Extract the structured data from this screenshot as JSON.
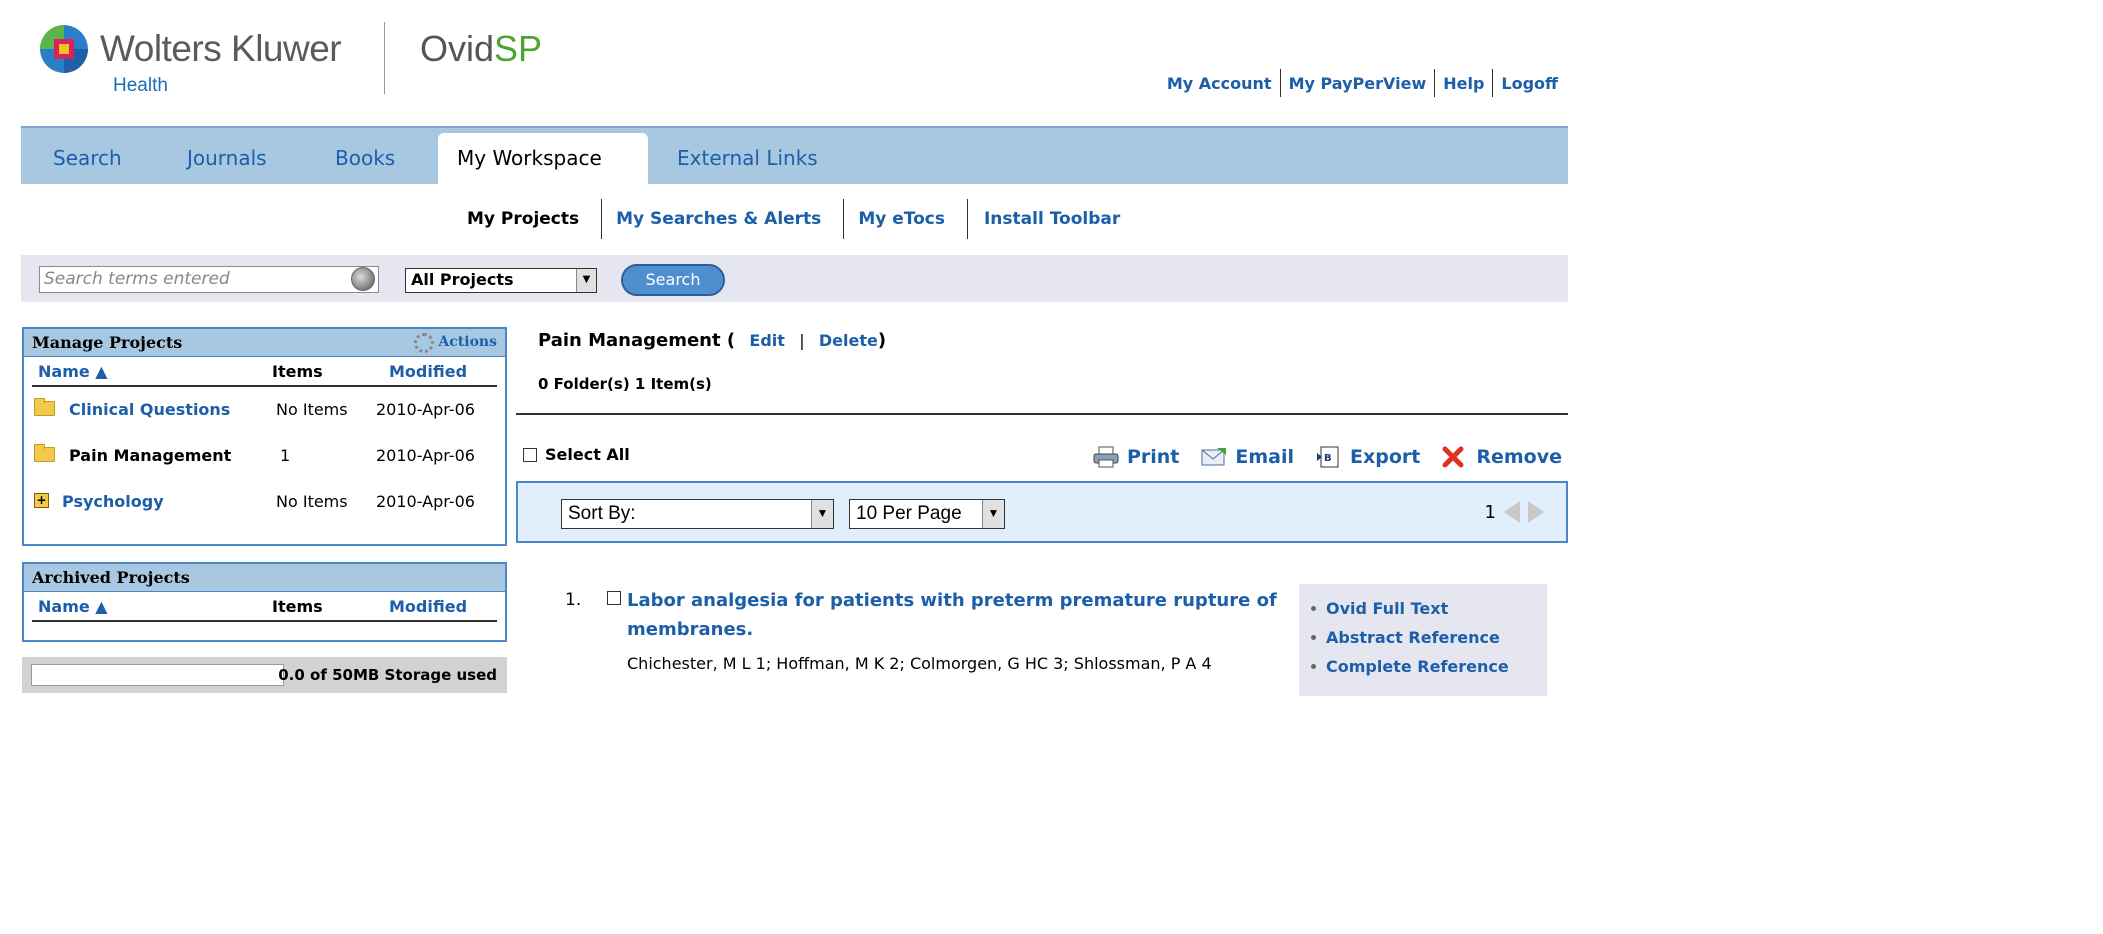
{
  "header": {
    "logo_text": "Wolters Kluwer",
    "logo_sub": "Health",
    "brand_prefix": "Ovid",
    "brand_suffix": "SP",
    "links": [
      "My Account",
      "My PayPerView",
      "Help",
      "Logoff"
    ]
  },
  "nav": {
    "tabs": [
      "Search",
      "Journals",
      "Books",
      "My Workspace",
      "External Links"
    ],
    "active_tab": "My Workspace"
  },
  "subnav": {
    "items": [
      "My Projects",
      "My Searches & Alerts",
      "My eTocs",
      "Install Toolbar"
    ],
    "active": "My Projects"
  },
  "search": {
    "placeholder": "Search terms entered",
    "scope": "All Projects",
    "button": "Search"
  },
  "manage_projects": {
    "title": "Manage Projects",
    "actions_label": "Actions",
    "columns": {
      "name": "Name ▲",
      "items": "Items",
      "modified": "Modified"
    },
    "rows": [
      {
        "name": "Clinical Questions",
        "items": "No Items",
        "modified": "2010-Apr-06",
        "icon": "folder-icon"
      },
      {
        "name": "Pain Management",
        "items": "1",
        "modified": "2010-Apr-06",
        "icon": "folder-icon"
      },
      {
        "name": "Psychology",
        "items": "No Items",
        "modified": "2010-Apr-06",
        "icon": "expand-icon"
      }
    ]
  },
  "archived_projects": {
    "title": "Archived Projects",
    "columns": {
      "name": "Name ▲",
      "items": "Items",
      "modified": "Modified"
    }
  },
  "storage": {
    "text": "0.0 of 50MB Storage used",
    "used_fraction": 0.0
  },
  "project": {
    "name": "Pain Management",
    "open_paren": "(",
    "edit": "Edit",
    "sep": "|",
    "delete": "Delete",
    "close_paren": ")",
    "summary": "0 Folder(s) 1 Item(s)"
  },
  "toolbar": {
    "select_all": "Select All",
    "print": "Print",
    "email": "Email",
    "export": "Export",
    "remove": "Remove"
  },
  "sort": {
    "sort_by": "Sort By:",
    "per_page": "10 Per Page",
    "page": "1"
  },
  "results": [
    {
      "number": "1.",
      "title": "Labor analgesia for patients with preterm premature rupture of membranes.",
      "authors": "Chichester, M L 1; Hoffman, M K 2; Colmorgen, G HC 3; Shlossman, P A 4",
      "links": [
        "Ovid Full Text",
        "Abstract Reference",
        "Complete Reference"
      ]
    }
  ],
  "colors": {
    "nav_blue": "#a8c8e2",
    "link_blue": "#1c5fa8",
    "panel_border": "#4a88c5",
    "search_bg": "#e6e6f0"
  }
}
